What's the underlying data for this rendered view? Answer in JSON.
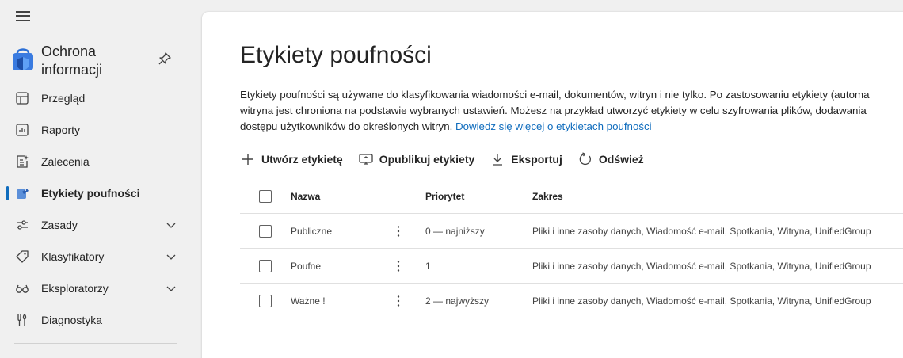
{
  "sidebar": {
    "app_title": "Ochrona informacji",
    "items": [
      {
        "label": "Przegląd",
        "icon": "overview-icon"
      },
      {
        "label": "Raporty",
        "icon": "reports-icon"
      },
      {
        "label": "Zalecenia",
        "icon": "recommendations-icon"
      },
      {
        "label": "Etykiety poufności",
        "icon": "sensitivity-label-icon",
        "active": true
      },
      {
        "label": "Zasady",
        "icon": "policies-icon",
        "expandable": true
      },
      {
        "label": "Klasyfikatory",
        "icon": "tag-icon",
        "expandable": true
      },
      {
        "label": "Eksploratorzy",
        "icon": "glasses-icon",
        "expandable": true
      },
      {
        "label": "Diagnostyka",
        "icon": "diagnostics-icon"
      }
    ]
  },
  "main": {
    "title": "Etykiety poufności",
    "description": {
      "line1": "Etykiety poufności są używane do klasyfikowania wiadomości e-mail, dokumentów, witryn i nie tylko. Po zastosowaniu etykiety (automa",
      "line2": "witryna jest chroniona na podstawie wybranych ustawień. Możesz na przykład utworzyć etykiety w celu szyfrowania plików, dodawania",
      "line3": "dostępu użytkowników do określonych witryn.",
      "link": "Dowiedz się więcej o etykietach poufności"
    },
    "toolbar": {
      "create": "Utwórz etykietę",
      "publish": "Opublikuj etykiety",
      "export": "Eksportuj",
      "refresh": "Odśwież"
    },
    "table": {
      "headers": {
        "name": "Nazwa",
        "priority": "Priorytet",
        "scope": "Zakres"
      },
      "rows": [
        {
          "name": "Publiczne",
          "priority": "0 — najniższy",
          "scope": "Pliki i inne zasoby danych, Wiadomość e-mail, Spotkania, Witryna, UnifiedGroup"
        },
        {
          "name": "Poufne",
          "priority": "1",
          "scope": "Pliki i inne zasoby danych, Wiadomość e-mail, Spotkania, Witryna, UnifiedGroup"
        },
        {
          "name": "Ważne !",
          "priority": "2 — najwyższy",
          "scope": "Pliki i inne zasoby danych, Wiadomość e-mail, Spotkania, Witryna, UnifiedGroup"
        }
      ]
    }
  },
  "colors": {
    "accent": "#0f6cbd",
    "sidebar_bg": "#f0f0f0",
    "content_bg": "#ffffff"
  }
}
